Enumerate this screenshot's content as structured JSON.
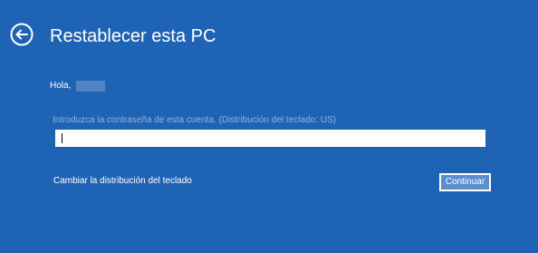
{
  "header": {
    "title": "Restablecer esta PC",
    "back_icon": "back-arrow-circle-icon"
  },
  "greeting": {
    "text": "Hola,"
  },
  "password": {
    "label": "Introduzca la contraseña de esta cuenta. (Distribución del teclado: US)",
    "value": ""
  },
  "actions": {
    "change_layout_label": "Cambiar la distribución del teclado",
    "continue_label": "Continuar"
  },
  "colors": {
    "background": "#1f64b4",
    "text": "#ffffff",
    "label_muted": "#8fb1de",
    "button_fill": "#5a8fcf"
  }
}
